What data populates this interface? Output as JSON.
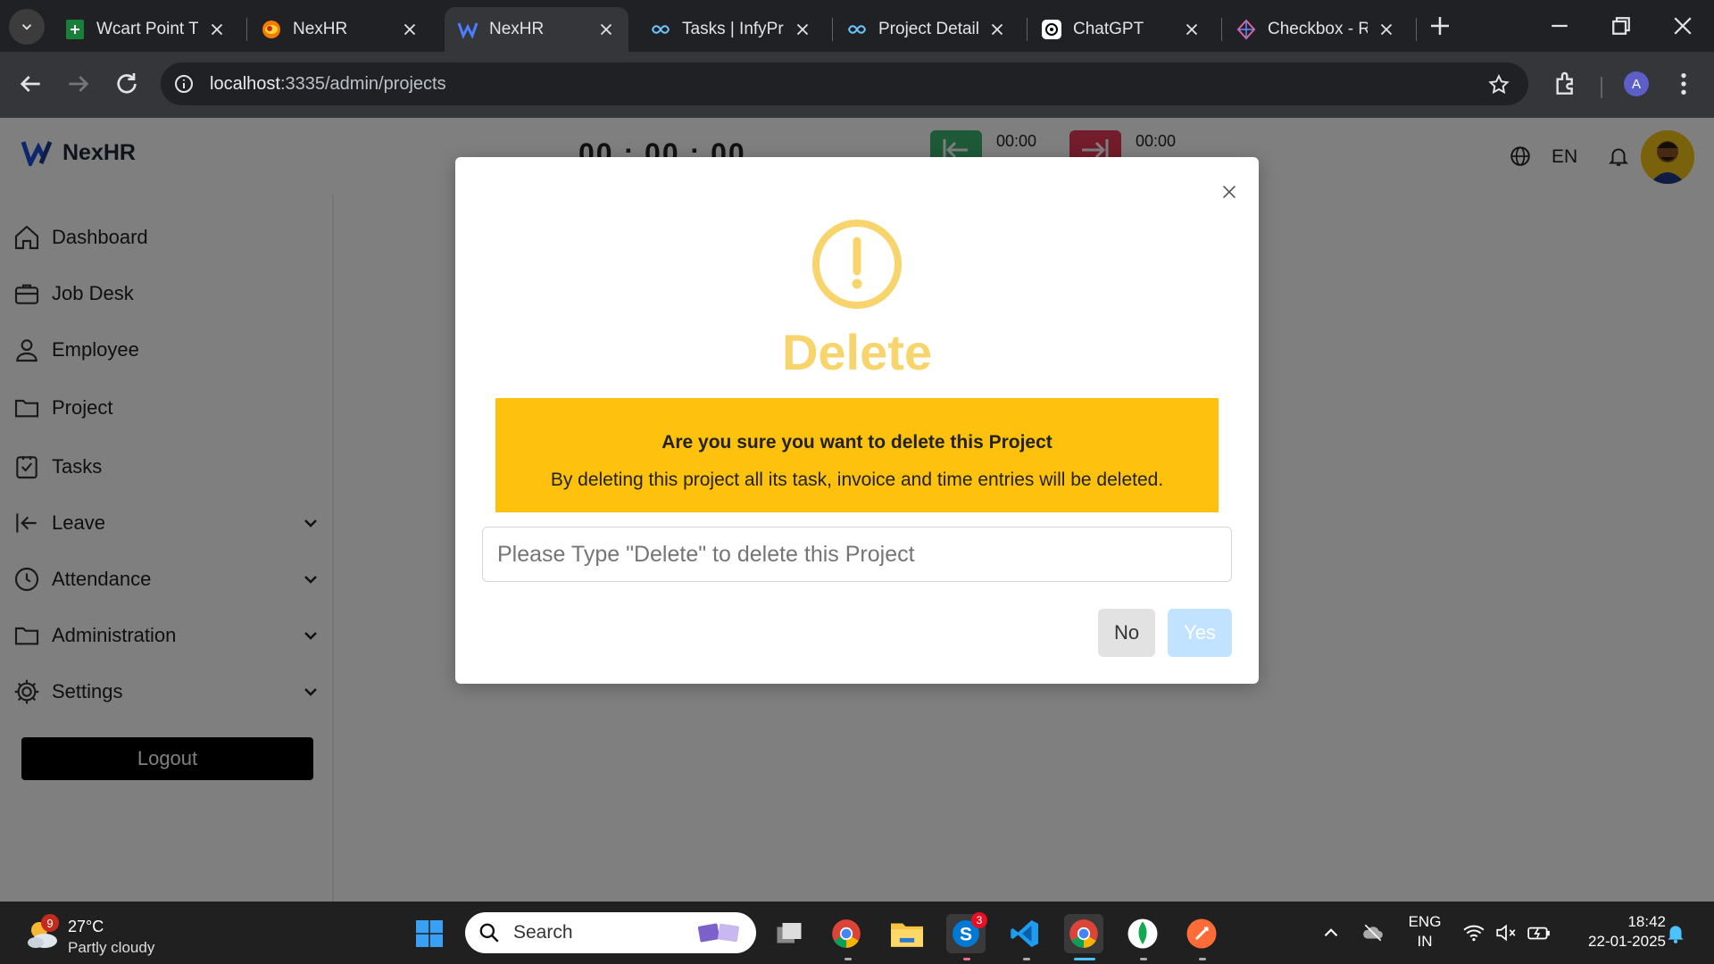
{
  "browser": {
    "tabs": [
      {
        "title": "Wcart Point Tr",
        "icon": "sheets-icon",
        "active": false
      },
      {
        "title": "NexHR",
        "icon": "nexhr-alt-icon",
        "active": false
      },
      {
        "title": "NexHR",
        "icon": "nexhr-icon",
        "active": true
      },
      {
        "title": "Tasks | InfyPro",
        "icon": "infy-icon",
        "active": false
      },
      {
        "title": "Project Details",
        "icon": "infy-icon",
        "active": false
      },
      {
        "title": "ChatGPT",
        "icon": "chatgpt-icon",
        "active": false
      },
      {
        "title": "Checkbox - Re",
        "icon": "checkbox-icon",
        "active": false
      }
    ],
    "url_host": "localhost",
    "url_path": ":3335/admin/projects",
    "profile_initial": "A"
  },
  "header": {
    "brand": "NexHR",
    "timer": "00 : 00 : 00",
    "clock_in_time": "00:00",
    "clock_out_time": "00:00",
    "language": "EN"
  },
  "sidebar": {
    "items": [
      {
        "label": "Dashboard",
        "icon": "home-icon",
        "expandable": false
      },
      {
        "label": "Job Desk",
        "icon": "briefcase-icon",
        "expandable": false
      },
      {
        "label": "Employee",
        "icon": "user-icon",
        "expandable": false
      },
      {
        "label": "Project",
        "icon": "folder-icon",
        "expandable": false
      },
      {
        "label": "Tasks",
        "icon": "checkbox-icon",
        "expandable": false
      },
      {
        "label": "Leave",
        "icon": "arrow-left-bar-icon",
        "expandable": true
      },
      {
        "label": "Attendance",
        "icon": "clock-icon",
        "expandable": true
      },
      {
        "label": "Administration",
        "icon": "folder-icon",
        "expandable": true
      },
      {
        "label": "Settings",
        "icon": "gear-icon",
        "expandable": true
      }
    ],
    "logout_label": "Logout"
  },
  "modal": {
    "title": "Delete",
    "warning_heading": "Are you sure you want to delete this Project",
    "warning_text": "By deleting this project all its task, invoice and time entries will be deleted.",
    "input_placeholder": "Please Type \"Delete\" to delete this Project",
    "input_value": "",
    "no_label": "No",
    "yes_label": "Yes"
  },
  "taskbar": {
    "weather_temp": "27°C",
    "weather_condition": "Partly cloudy",
    "weather_badge": "9",
    "search_label": "Search",
    "skype_badge": "3",
    "lang_line1": "ENG",
    "lang_line2": "IN",
    "time": "18:42",
    "date": "22-01-2025"
  },
  "colors": {
    "warning_yellow": "#fec10d",
    "title_yellow": "#f8d46c",
    "yes_button": "#c2e3ff",
    "clock_in": "#3cb371",
    "clock_out": "#e53958"
  }
}
